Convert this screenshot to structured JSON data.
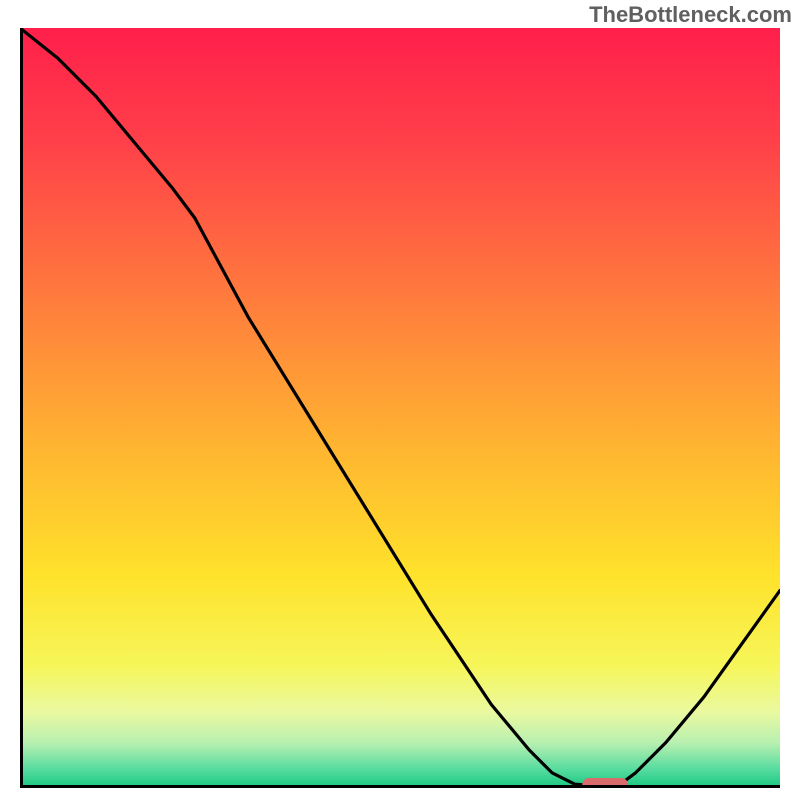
{
  "watermark": "TheBottleneck.com",
  "chart_data": {
    "type": "line",
    "title": "",
    "xlabel": "",
    "ylabel": "",
    "xlim": [
      0,
      100
    ],
    "ylim": [
      0,
      100
    ],
    "series": [
      {
        "name": "curve",
        "x": [
          0,
          5,
          10,
          15,
          20,
          23,
          30,
          38,
          46,
          54,
          62,
          67,
          70,
          73,
          76,
          79,
          81,
          85,
          90,
          95,
          100
        ],
        "y": [
          100,
          96,
          91,
          85,
          79,
          75,
          62,
          49,
          36,
          23,
          11,
          5,
          2,
          0.5,
          0.3,
          0.5,
          2,
          6,
          12,
          19,
          26
        ]
      }
    ],
    "marker": {
      "x": 77,
      "y": 0.4
    },
    "gradient_stops": [
      {
        "offset": 0.0,
        "color": "#ff1f4b"
      },
      {
        "offset": 0.15,
        "color": "#ff4049"
      },
      {
        "offset": 0.35,
        "color": "#ff7a3d"
      },
      {
        "offset": 0.55,
        "color": "#ffb431"
      },
      {
        "offset": 0.72,
        "color": "#ffe22b"
      },
      {
        "offset": 0.84,
        "color": "#f6f65a"
      },
      {
        "offset": 0.9,
        "color": "#eaf9a0"
      },
      {
        "offset": 0.94,
        "color": "#b9f0b0"
      },
      {
        "offset": 0.975,
        "color": "#58dca0"
      },
      {
        "offset": 1.0,
        "color": "#17c77f"
      }
    ]
  }
}
